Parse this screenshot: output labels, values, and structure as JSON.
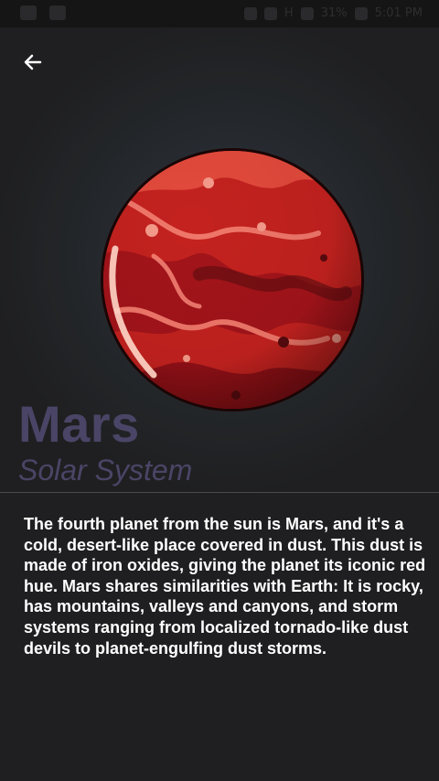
{
  "status_bar": {
    "battery": "31%",
    "network": "H",
    "time": "5:01 PM"
  },
  "planet": {
    "name": "Mars",
    "category": "Solar System",
    "description": "The fourth planet from the sun is Mars, and it's a cold, desert-like place covered in dust. This dust is made of iron oxides, giving the planet its iconic red hue. Mars shares similarities with Earth: It is rocky, has mountains, valleys and canyons, and storm systems ranging from localized tornado-like dust devils to planet-engulfing dust storms."
  },
  "icons": {
    "back": "arrow-left-icon",
    "planet": "mars-illustration"
  },
  "colors": {
    "background": "#1f1f21",
    "title": "#4a4566",
    "text": "#ffffff",
    "planet_base": "#c4221f"
  }
}
